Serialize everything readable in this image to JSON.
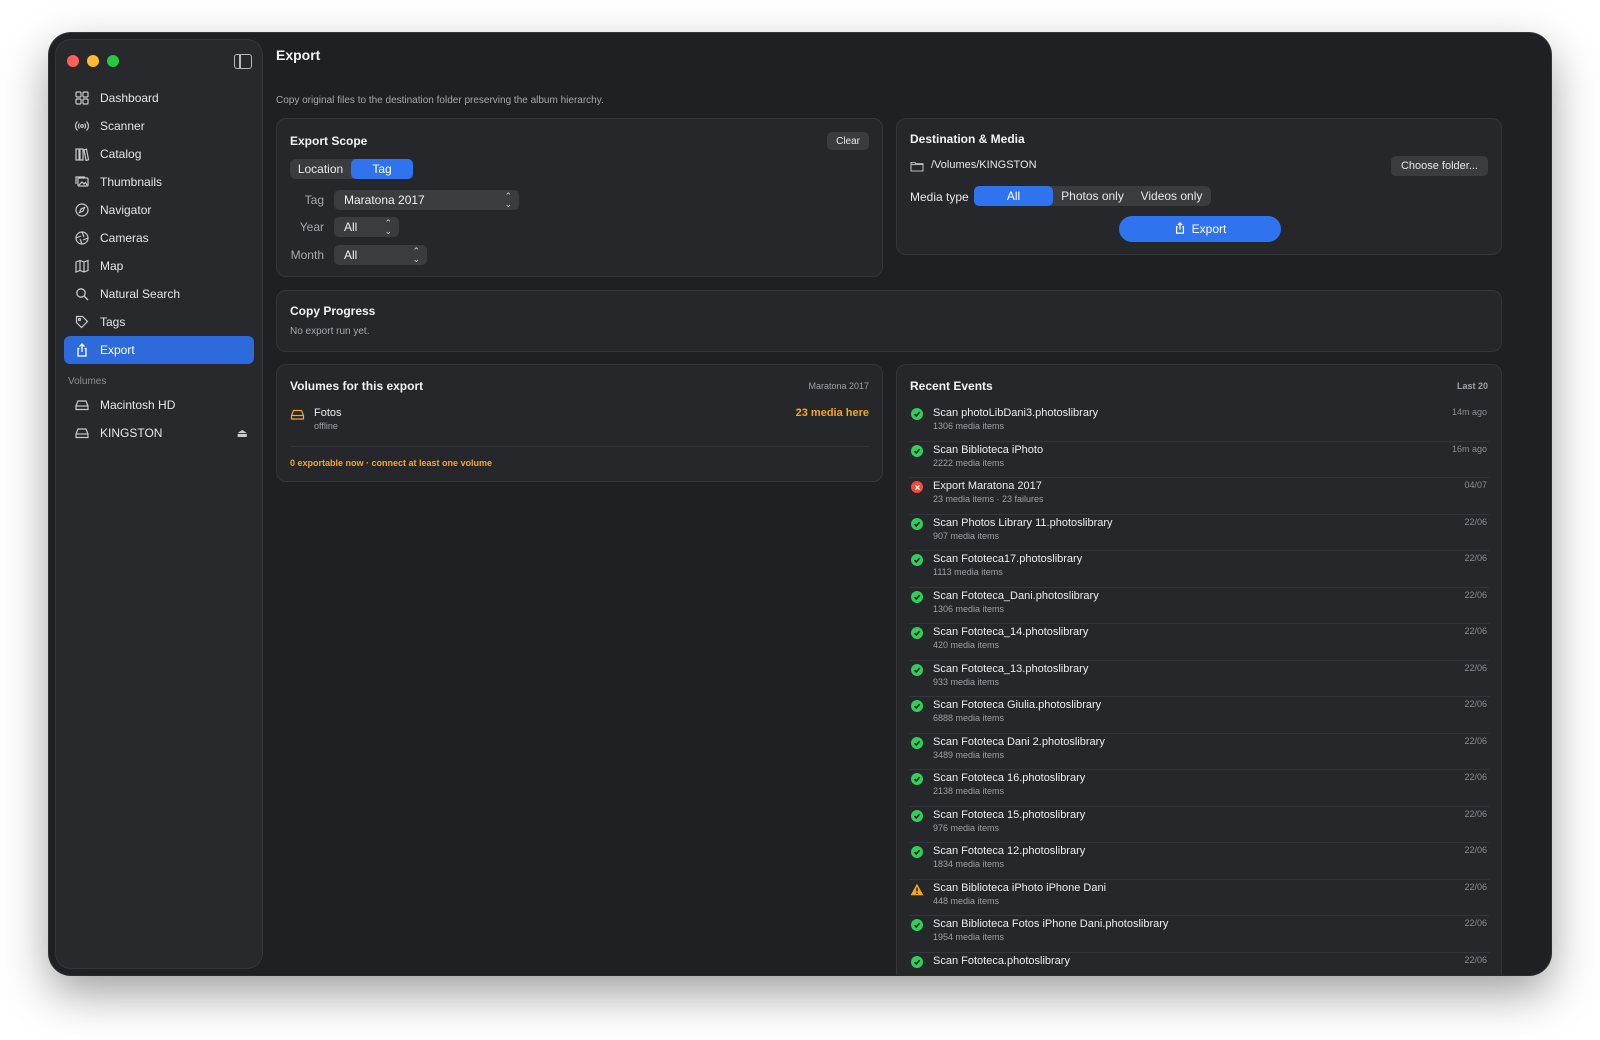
{
  "sidebar": {
    "items": [
      {
        "label": "Dashboard",
        "icon": "grid-icon"
      },
      {
        "label": "Scanner",
        "icon": "broadcast-icon"
      },
      {
        "label": "Catalog",
        "icon": "books-icon"
      },
      {
        "label": "Thumbnails",
        "icon": "photos-icon"
      },
      {
        "label": "Navigator",
        "icon": "compass-icon"
      },
      {
        "label": "Cameras",
        "icon": "aperture-icon"
      },
      {
        "label": "Map",
        "icon": "map-icon"
      },
      {
        "label": "Natural Search",
        "icon": "magnifier-icon"
      },
      {
        "label": "Tags",
        "icon": "tag-icon"
      },
      {
        "label": "Export",
        "icon": "share-icon"
      }
    ],
    "volumes_heading": "Volumes",
    "volumes": [
      {
        "label": "Macintosh HD",
        "icon": "drive-icon"
      },
      {
        "label": "KINGSTON",
        "icon": "drive-icon",
        "eject": "⏏"
      }
    ]
  },
  "page": {
    "title": "Export",
    "subtitle": "Copy original files to the destination folder preserving the album hierarchy."
  },
  "scope": {
    "title": "Export Scope",
    "clear_label": "Clear",
    "segments": [
      "Location",
      "Tag"
    ],
    "selected_segment": "Tag",
    "tag_label": "Tag",
    "tag_value": "Maratona 2017",
    "year_label": "Year",
    "year_value": "All",
    "month_label": "Month",
    "month_value": "All"
  },
  "destination": {
    "title": "Destination & Media",
    "path": "/Volumes/KINGSTON",
    "choose_label": "Choose folder...",
    "media_type_label": "Media type",
    "media_segments": [
      "All",
      "Photos only",
      "Videos only"
    ],
    "selected_media": "All",
    "export_label": "Export"
  },
  "progress": {
    "title": "Copy Progress",
    "status": "No export run yet."
  },
  "volumes_panel": {
    "title": "Volumes for this export",
    "badge": "Maratona 2017",
    "volume_name": "Fotos",
    "volume_status": "offline",
    "media_count": "23 media here",
    "warning": "0 exportable now · connect at least one volume",
    "accent_color": "#f5a623"
  },
  "events": {
    "title": "Recent Events",
    "badge": "Last 20",
    "items": [
      {
        "status": "ok",
        "title": "Scan photoLibDani3.photoslibrary",
        "sub": "1306 media items",
        "time": "14m ago"
      },
      {
        "status": "ok",
        "title": "Scan Biblioteca iPhoto",
        "sub": "2222 media items",
        "time": "16m ago"
      },
      {
        "status": "fail",
        "title": "Export Maratona 2017",
        "sub": "23 media items · 23 failures",
        "time": "04/07"
      },
      {
        "status": "ok",
        "title": "Scan Photos Library 11.photoslibrary",
        "sub": "907 media items",
        "time": "22/06"
      },
      {
        "status": "ok",
        "title": "Scan Fototeca17.photoslibrary",
        "sub": "1113 media items",
        "time": "22/06"
      },
      {
        "status": "ok",
        "title": "Scan Fototeca_Dani.photoslibrary",
        "sub": "1306 media items",
        "time": "22/06"
      },
      {
        "status": "ok",
        "title": "Scan Fototeca_14.photoslibrary",
        "sub": "420 media items",
        "time": "22/06"
      },
      {
        "status": "ok",
        "title": "Scan Fototeca_13.photoslibrary",
        "sub": "933 media items",
        "time": "22/06"
      },
      {
        "status": "ok",
        "title": "Scan Fototeca Giulia.photoslibrary",
        "sub": "6888 media items",
        "time": "22/06"
      },
      {
        "status": "ok",
        "title": "Scan Fototeca Dani 2.photoslibrary",
        "sub": "3489 media items",
        "time": "22/06"
      },
      {
        "status": "ok",
        "title": "Scan Fototeca 16.photoslibrary",
        "sub": "2138 media items",
        "time": "22/06"
      },
      {
        "status": "ok",
        "title": "Scan Fototeca 15.photoslibrary",
        "sub": "976 media items",
        "time": "22/06"
      },
      {
        "status": "ok",
        "title": "Scan Fototeca 12.photoslibrary",
        "sub": "1834 media items",
        "time": "22/06"
      },
      {
        "status": "warn",
        "title": "Scan Biblioteca iPhoto iPhone Dani",
        "sub": "448 media items",
        "time": "22/06"
      },
      {
        "status": "ok",
        "title": "Scan Biblioteca Fotos iPhone Dani.photoslibrary",
        "sub": "1954 media items",
        "time": "22/06"
      },
      {
        "status": "ok",
        "title": "Scan Fototeca.photoslibrary",
        "sub": "",
        "time": "22/06"
      }
    ]
  },
  "colors": {
    "accent": "#2f73ee",
    "success": "#2fcf5a",
    "error": "#ff453a",
    "warning": "#f5a623"
  }
}
